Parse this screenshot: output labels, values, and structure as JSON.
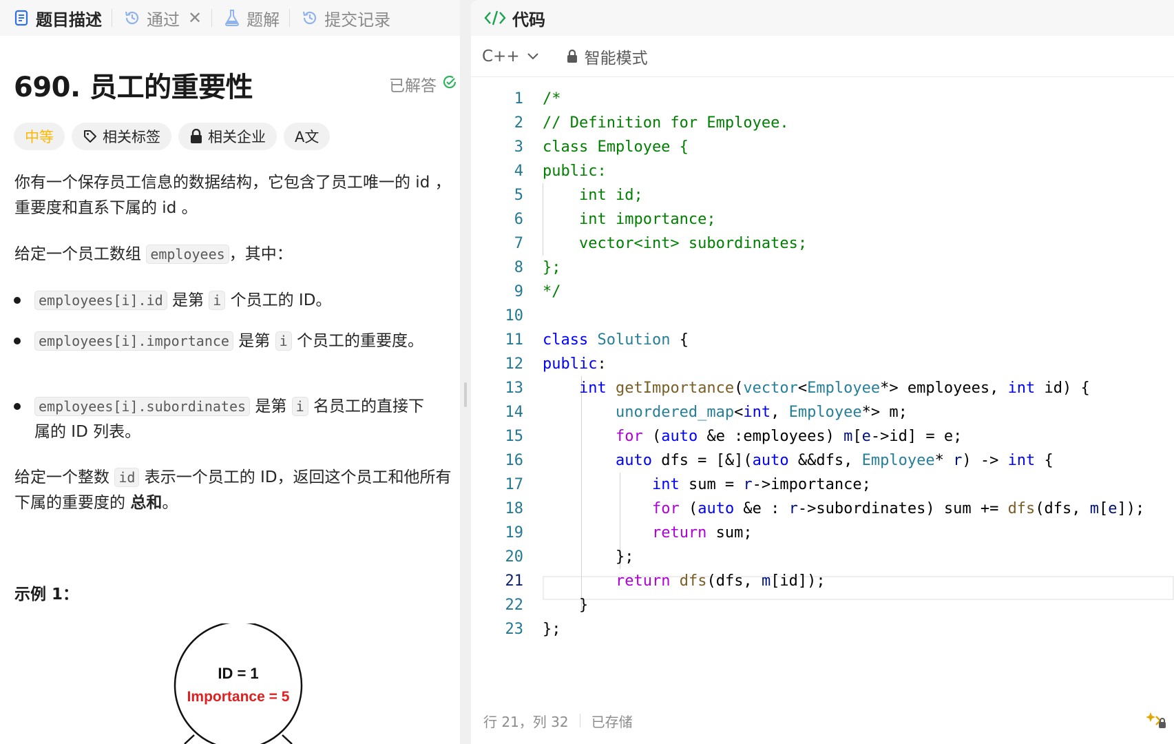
{
  "left_tabs": [
    {
      "label": "题目描述"
    },
    {
      "label": "通过"
    },
    {
      "label": "题解"
    },
    {
      "label": "提交记录"
    }
  ],
  "close_glyph": "✕",
  "problem": {
    "title": "690. 员工的重要性",
    "status": "已解答",
    "tags": {
      "difficulty": "中等",
      "related_tags": "相关标签",
      "related_companies": "相关企业",
      "translate": "A文"
    },
    "para1": "你有一个保存员工信息的数据结构，它包含了员工唯一的 id ，重要度和直系下属的 id 。",
    "para2_prefix": "给定一个员工数组",
    "para2_code": "employees",
    "para2_suffix": "，其中：",
    "bullets": [
      {
        "code": "employees[i].id",
        "mid": "是第",
        "var": "i",
        "text": "个员工的 ID。"
      },
      {
        "code": "employees[i].importance",
        "mid": "是第",
        "var": "i",
        "text": "个员工的重要度。"
      },
      {
        "code": "employees[i].subordinates",
        "mid": "是第",
        "var": "i",
        "text": "名员工的直接下属的 ID 列表。"
      }
    ],
    "para3_prefix": "给定一个整数",
    "para3_code": "id",
    "para3_mid": "表示一个员工的 ID，返回这个员工和他所有下属的重要度的",
    "para3_bold": "总和",
    "para3_end": "。",
    "example_label": "示例 1：",
    "diagram": {
      "node_id": "ID = 1",
      "node_importance": "Importance = 5"
    }
  },
  "code_panel": {
    "title": "代码",
    "language": "C++",
    "mode": "智能模式"
  },
  "status_bar": {
    "cursor": "行 21，列 32",
    "saved": "已存储"
  },
  "code_lines": [
    "/*",
    "// Definition for Employee.",
    "class Employee {",
    "public:",
    "    int id;",
    "    int importance;",
    "    vector<int> subordinates;",
    "};",
    "*/",
    "",
    "class Solution {",
    "public:",
    "    int getImportance(vector<Employee*> employees, int id) {",
    "        unordered_map<int, Employee*> m;",
    "        for (auto &e :employees) m[e->id] = e;",
    "        auto dfs = [&](auto &&dfs, Employee* r) -> int {",
    "            int sum = r->importance;",
    "            for (auto &e : r->subordinates) sum += dfs(dfs, m[e]);",
    "            return sum;",
    "        };",
    "        return dfs(dfs, m[id]);",
    "    }",
    "};"
  ],
  "line_numbers": [
    "1",
    "2",
    "3",
    "4",
    "5",
    "6",
    "7",
    "8",
    "9",
    "10",
    "11",
    "12",
    "13",
    "14",
    "15",
    "16",
    "17",
    "18",
    "19",
    "20",
    "21",
    "22",
    "23"
  ],
  "current_line": "21"
}
